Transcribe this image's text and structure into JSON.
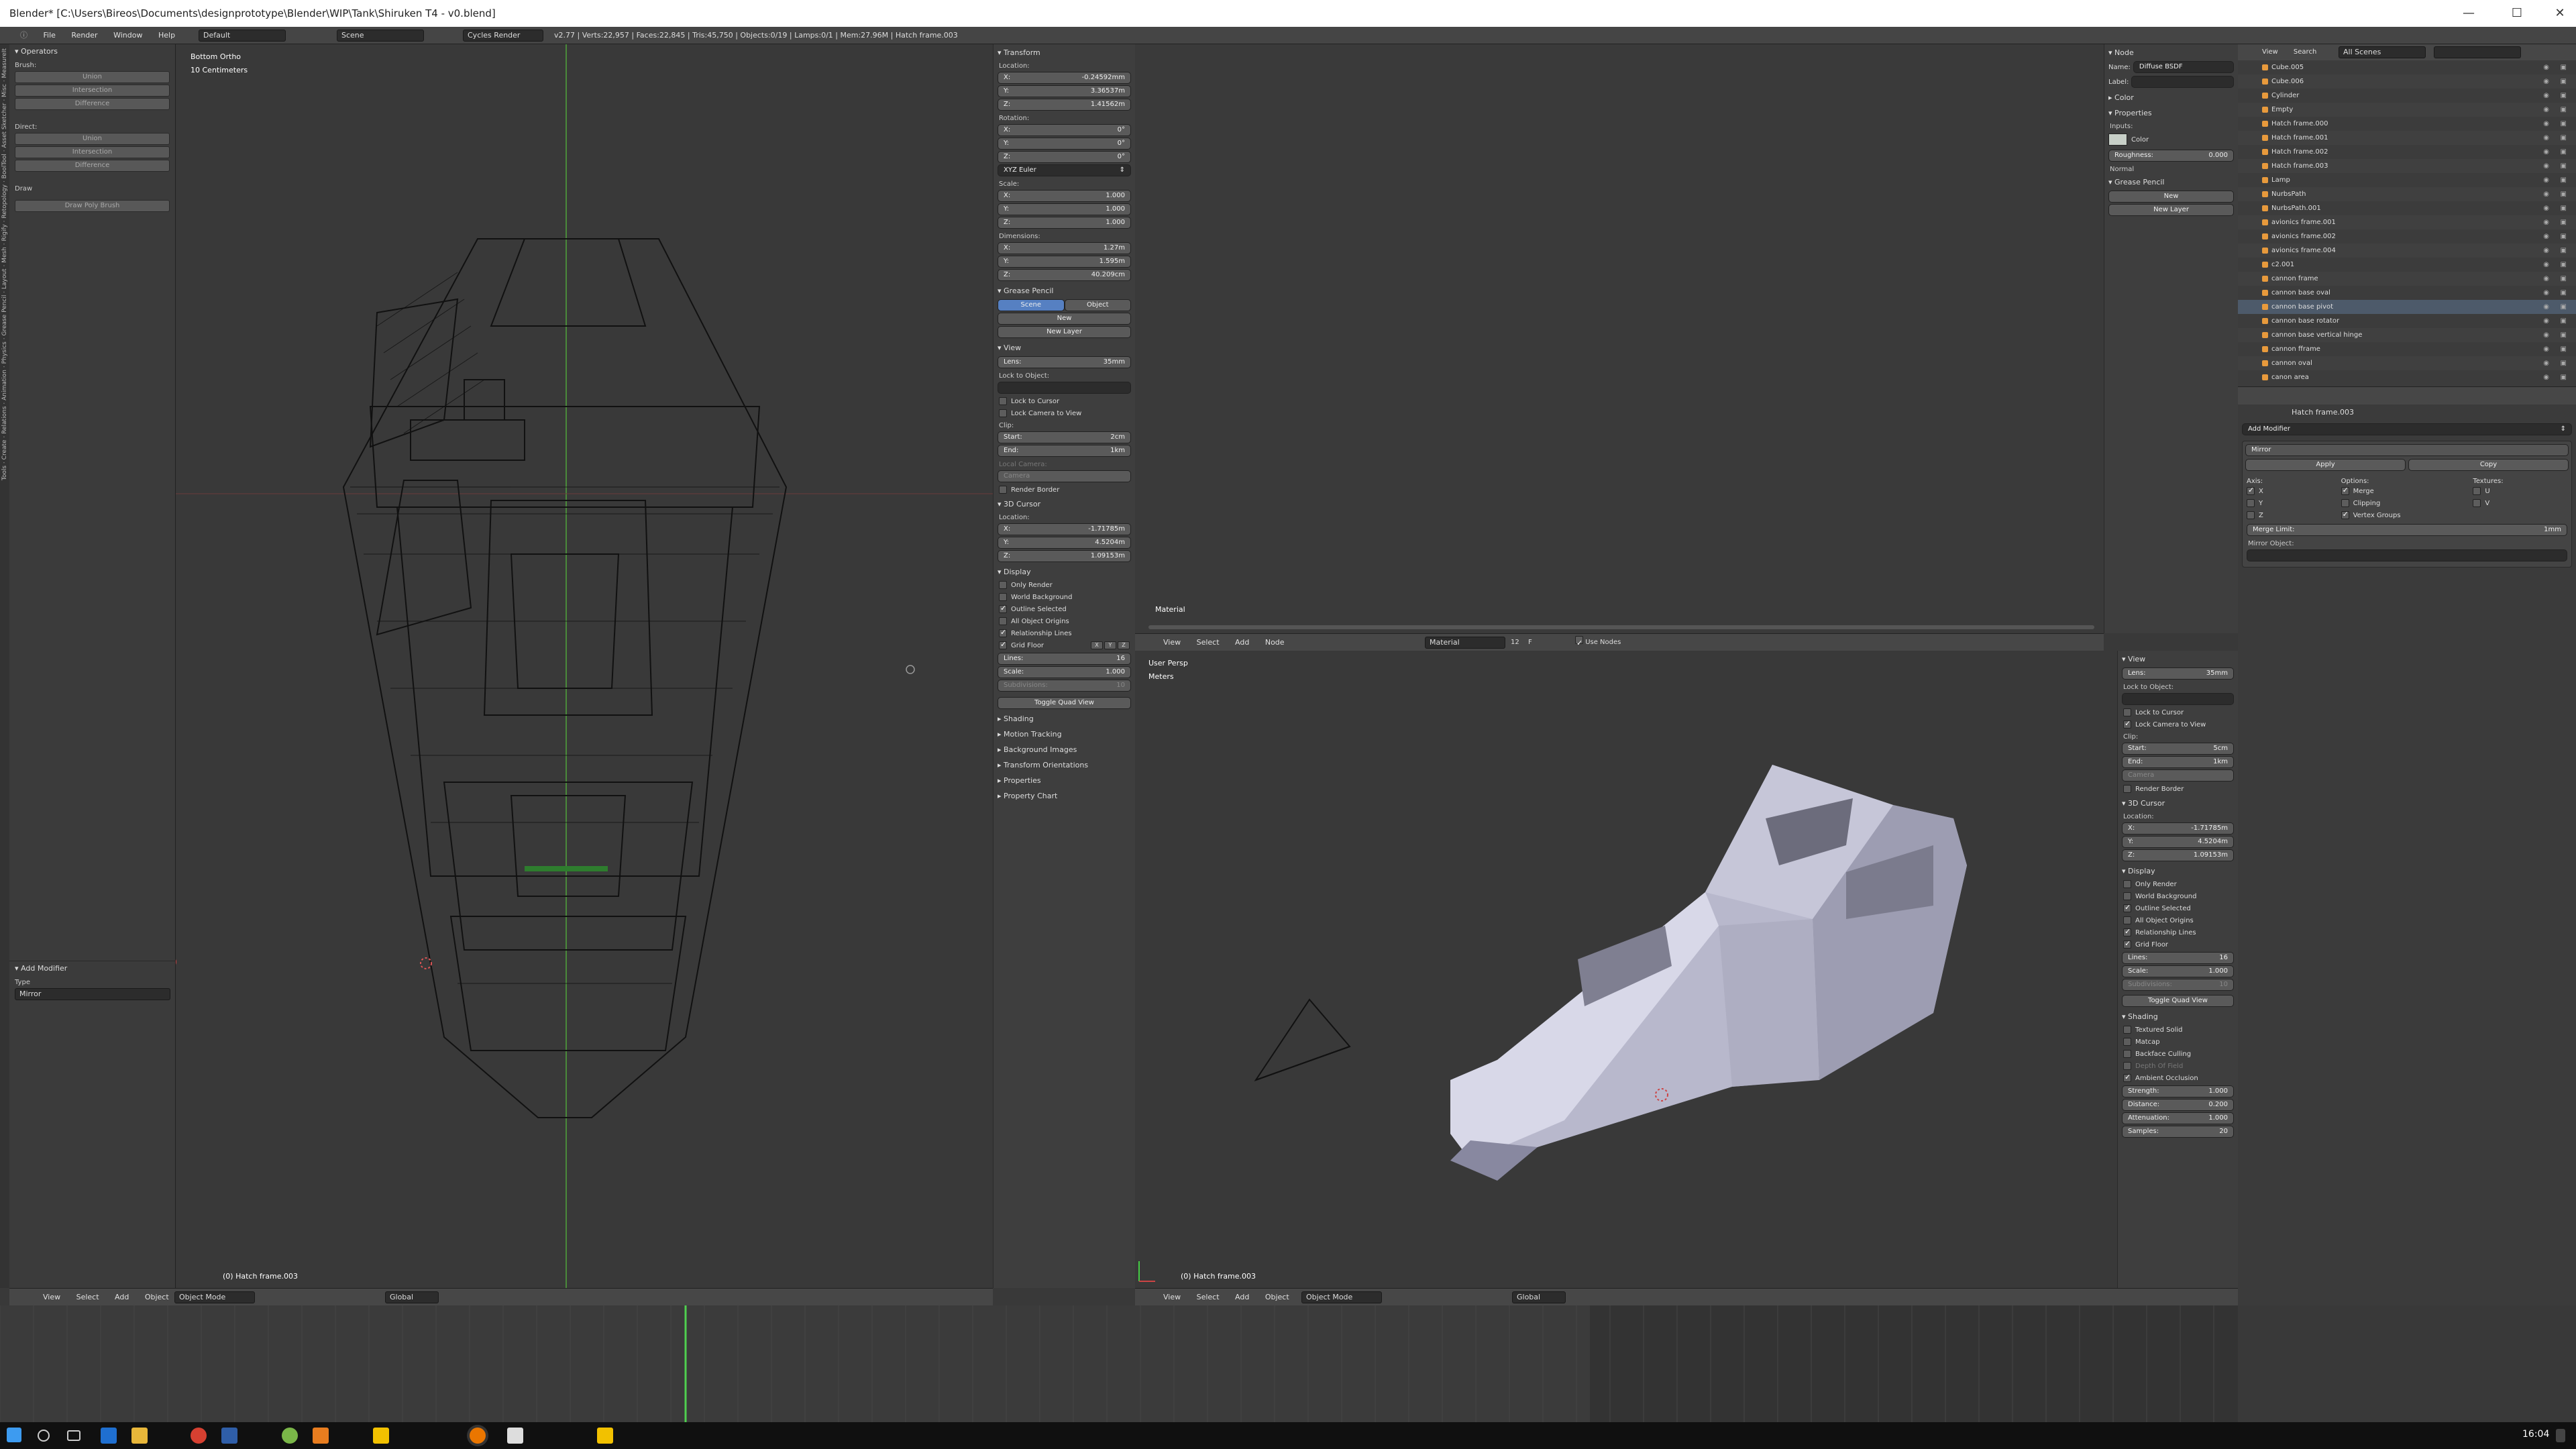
{
  "window": {
    "title": "Blender* [C:\\Users\\Bireos\\Documents\\designprototype\\Blender\\WIP\\Tank\\Shiruken T4 - v0.blend]",
    "min": "—",
    "max": "☐",
    "close": "✕"
  },
  "infobar": {
    "menus": [
      "File",
      "Render",
      "Window",
      "Help"
    ],
    "layout": "Default",
    "scene": "Scene",
    "engine": "Cycles Render",
    "stats": "v2.77 | Verts:22,957 | Faces:22,845 | Tris:45,750 | Objects:0/19 | Lamps:0/1 | Mem:27.96M | Hatch frame.003"
  },
  "sidetabs": [
    "Tools",
    "Create",
    "Relations",
    "Animation",
    "Physics",
    "Grease Pencil",
    "Layout",
    "Mesh",
    "Rigify",
    "Retopology",
    "BoolTool",
    "Asset Sketcher",
    "Misc",
    "MeasureIt"
  ],
  "toolshelf": {
    "operators": "Operators",
    "brush": "Brush:",
    "brush_buttons": [
      "Union",
      "Intersection",
      "Difference"
    ],
    "direct": "Direct:",
    "direct_buttons": [
      "Union",
      "Intersection",
      "Difference"
    ],
    "draw": "Draw",
    "draw_poly": "Draw Poly Brush",
    "add_modifier": "Add Modifier",
    "type": "Type",
    "type_value": "Mirror"
  },
  "left_viewport": {
    "view_name": "Bottom Ortho",
    "scale": "10 Centimeters",
    "object": "(0) Hatch frame.003",
    "header": [
      "View",
      "Select",
      "Add",
      "Object"
    ],
    "mode": "Object Mode",
    "orientation": "Global"
  },
  "npanel": {
    "transform": "Transform",
    "location": "Location:",
    "loc": [
      [
        "X:",
        "-0.24592mm"
      ],
      [
        "Y:",
        "3.36537m"
      ],
      [
        "Z:",
        "1.41562m"
      ]
    ],
    "rotation": "Rotation:",
    "rot": [
      [
        "X:",
        "0°"
      ],
      [
        "Y:",
        "0°"
      ],
      [
        "Z:",
        "0°"
      ]
    ],
    "rotmode": "XYZ Euler",
    "scale": "Scale:",
    "scl": [
      [
        "X:",
        "1.000"
      ],
      [
        "Y:",
        "1.000"
      ],
      [
        "Z:",
        "1.000"
      ]
    ],
    "dimensions": "Dimensions:",
    "dim": [
      [
        "X:",
        "1.27m"
      ],
      [
        "Y:",
        "1.595m"
      ],
      [
        "Z:",
        "40.209cm"
      ]
    ],
    "grease_pencil": "Grease Pencil",
    "gp_scene": "Scene",
    "gp_object": "Object",
    "gp_new": "New",
    "gp_new_layer": "New Layer",
    "view": "View",
    "lens": [
      "Lens:",
      "35mm"
    ],
    "lock_to_object": "Lock to Object:",
    "lock_cursor": "Lock to Cursor",
    "lock_camera": "Lock Camera to View",
    "clip": "Clip:",
    "clip_start": [
      "Start:",
      "2cm"
    ],
    "clip_end": [
      "End:",
      "1km"
    ],
    "local_camera": "Local Camera:",
    "camera": "Camera",
    "render_border": "Render Border",
    "cursor3d": "3D Cursor",
    "cursor_location": "Location:",
    "cur": [
      [
        "X:",
        "-1.71785m"
      ],
      [
        "Y:",
        "4.5204m"
      ],
      [
        "Z:",
        "1.09153m"
      ]
    ],
    "display": "Display",
    "only_render": "Only Render",
    "world_bg": "World Background",
    "outline_sel": "Outline Selected",
    "all_origins": "All Object Origins",
    "rel_lines": "Relationship Lines",
    "grid_floor": "Grid Floor",
    "axes": [
      "X",
      "Y",
      "Z"
    ],
    "lines": [
      "Lines:",
      "16"
    ],
    "gscale": [
      "Scale:",
      "1.000"
    ],
    "subdiv": [
      "Subdivisions:",
      "10"
    ],
    "toggle_quad": "Toggle Quad View",
    "shading": "Shading",
    "motion": "Motion Tracking",
    "bg_images": "Background Images",
    "transform_orient": "Transform Orientations",
    "properties": "Properties",
    "property_chart": "Property Chart"
  },
  "node_editor": {
    "label": "Material",
    "header": [
      "View",
      "Select",
      "Add",
      "Node"
    ],
    "material": "Material",
    "users": "12",
    "fake": "F",
    "use_nodes": "Use Nodes"
  },
  "node_panel": {
    "node": "Node",
    "name_label": "Name:",
    "name_value": "Diffuse BSDF",
    "label_label": "Label:",
    "color": "Color",
    "properties": "Properties",
    "inputs": "Inputs:",
    "color_in": "Color",
    "roughness": [
      "Roughness:",
      "0.000"
    ],
    "normal": "Normal",
    "grease_pencil": "Grease Pencil",
    "new": "New",
    "new_layer": "New Layer"
  },
  "persp_viewport": {
    "view_name": "User Persp",
    "units": "Meters",
    "object": "(0) Hatch frame.003",
    "header": [
      "View",
      "Select",
      "Add",
      "Object"
    ],
    "mode": "Object Mode",
    "orientation": "Global"
  },
  "persp_npanel": {
    "view": "View",
    "lens": [
      "Lens:",
      "35mm"
    ],
    "lock_to_object": "Lock to Object:",
    "lock_cursor": "Lock to Cursor",
    "lock_camera": "Lock Camera to View",
    "clip": "Clip:",
    "clip_start": [
      "Start:",
      "5cm"
    ],
    "clip_end": [
      "End:",
      "1km"
    ],
    "camera": "Camera",
    "render_border": "Render Border",
    "cursor3d": "3D Cursor",
    "cursor_location": "Location:",
    "cur": [
      [
        "X:",
        "-1.71785m"
      ],
      [
        "Y:",
        "4.5204m"
      ],
      [
        "Z:",
        "1.09153m"
      ]
    ],
    "display": "Display",
    "only_render": "Only Render",
    "world_bg": "World Background",
    "outline_sel": "Outline Selected",
    "all_origins": "All Object Origins",
    "rel_lines": "Relationship Lines",
    "grid_floor": "Grid Floor",
    "lines": [
      "Lines:",
      "16"
    ],
    "gscale": [
      "Scale:",
      "1.000"
    ],
    "subdiv": [
      "Subdivisions:",
      "10"
    ],
    "toggle_quad": "Toggle Quad View",
    "shading": "Shading",
    "textured_solid": "Textured Solid",
    "matcap": "Matcap",
    "backface": "Backface Culling",
    "dof": "Depth Of Field",
    "ao": "Ambient Occlusion",
    "strength": [
      "Strength:",
      "1.000"
    ],
    "distance": [
      "Distance:",
      "0.200"
    ],
    "attenuation": [
      "Attenuation:",
      "1.000"
    ],
    "samples": [
      "Samples:",
      "20"
    ]
  },
  "outliner": {
    "view": "View",
    "search": "Search",
    "scenes": "All Scenes",
    "items": [
      "Cube.005",
      "Cube.006",
      "Cylinder",
      "Empty",
      "Hatch frame.000",
      "Hatch frame.001",
      "Hatch frame.002",
      "Hatch frame.003",
      "Lamp",
      "NurbsPath",
      "NurbsPath.001",
      "avionics frame.001",
      "avionics frame.002",
      "avionics frame.004",
      "c2.001",
      "cannon frame",
      "cannon base oval",
      "cannon base pivot",
      "cannon base rotator",
      "cannon base vertical hinge",
      "cannon fframe",
      "cannon oval",
      "canon area"
    ]
  },
  "properties": {
    "object": "Hatch frame.003",
    "add_modifier": "Add Modifier",
    "modifier": "Mirror",
    "apply": "Apply",
    "copy": "Copy",
    "axis": "Axis:",
    "options": "Options:",
    "textures": "Textures:",
    "axis_items": [
      "X",
      "Y",
      "Z"
    ],
    "opt_items": [
      "Merge",
      "Clipping",
      "Vertex Groups"
    ],
    "tex_items": [
      "U",
      "V"
    ],
    "merge_limit": [
      "Merge Limit:",
      "1mm"
    ],
    "mirror_object": "Mirror Object:"
  },
  "taskbar": {
    "time": "16:04"
  }
}
